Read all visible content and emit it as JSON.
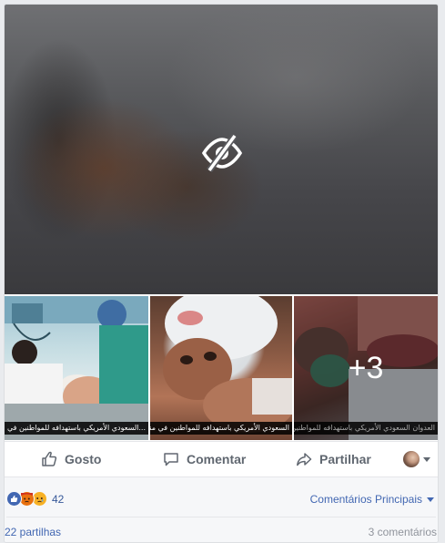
{
  "media": {
    "hero_icon": "eye-slash-icon",
    "thumbnails": [
      {
        "caption": "...السعودي الأمريكي باستهدافه للمواطنين في منطقة آل ثابل بالقرب من"
      },
      {
        "caption": "السعودي الأمريكي باستهدافه للمواطنين في منطقة آل ثابل بالقرب من"
      },
      {
        "caption": "العدوان السعودي الأمريكي باستهدافه للمواطنين في منطقة آل ثابل بالقرب من مديرية"
      }
    ],
    "more_count": "+3"
  },
  "actions": {
    "like_label": "Gosto",
    "comment_label": "Comentar",
    "share_label": "Partilhar"
  },
  "reactions": {
    "count": "42",
    "types": [
      "like",
      "angry",
      "sad"
    ],
    "colors": {
      "like": "#4267b2",
      "angry": "#e9710f",
      "sad": "#f7b125"
    }
  },
  "comments_sort": {
    "label": "Comentários Principais"
  },
  "stats": {
    "shares": "22 partilhas",
    "comments": "3 comentários"
  }
}
